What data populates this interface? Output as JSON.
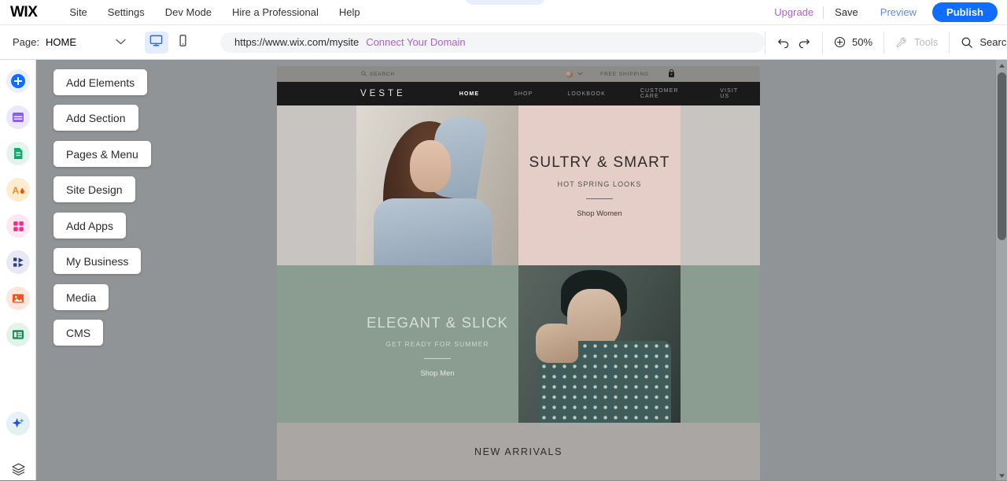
{
  "topbar": {
    "logo": "WIX",
    "menu": [
      {
        "label": "Site"
      },
      {
        "label": "Settings"
      },
      {
        "label": "Dev Mode"
      },
      {
        "label": "Hire a Professional"
      },
      {
        "label": "Help"
      }
    ],
    "upgrade_label": "Upgrade",
    "save_label": "Save",
    "preview_label": "Preview",
    "publish_label": "Publish",
    "publish_color": "#116dff",
    "upgrade_color": "#b65ad7",
    "preview_color": "#5b8bf6"
  },
  "toolbar": {
    "page_label": "Page:",
    "page_value": "HOME",
    "page_chevron": "chevron-down-icon",
    "desktop_icon": "desktop-view-icon",
    "mobile_icon": "mobile-view-icon",
    "active_device": "desktop",
    "url": "https://www.wix.com/mysite",
    "connect_domain_label": "Connect Your Domain",
    "connect_domain_color": "#b65ad7",
    "undo_icon": "undo-icon",
    "redo_icon": "redo-icon",
    "zoom_icon": "zoom-in-icon",
    "zoom_level": "50%",
    "tools_icon": "tools-icon",
    "tools_label": "Tools",
    "tools_disabled_color": "#bcbcbc",
    "search_icon": "search-icon",
    "search_label": "Search"
  },
  "rail": {
    "items": [
      {
        "name": "add-icon",
        "bg": "#e8f0fe",
        "fg": "#116dff"
      },
      {
        "name": "sections-icon",
        "bg": "#ede7fd",
        "fg": "#8b5cf6"
      },
      {
        "name": "pages-menu-icon",
        "bg": "#e2f5ec",
        "fg": "#16a86a"
      },
      {
        "name": "site-design-icon",
        "bg": "#fdeccd",
        "fg": "#f5851f"
      },
      {
        "name": "add-apps-icon",
        "bg": "#fde7f1",
        "fg": "#ec2c8f"
      },
      {
        "name": "my-business-icon",
        "bg": "#e7eaf4",
        "fg": "#2d3f8f"
      },
      {
        "name": "media-icon",
        "bg": "#fde6dc",
        "fg": "#f0531c"
      },
      {
        "name": "cms-icon",
        "bg": "#e2f3e9",
        "fg": "#0f8a52"
      }
    ],
    "bottom": [
      {
        "name": "ai-sparkle-icon"
      },
      {
        "name": "layers-icon"
      }
    ]
  },
  "panel": {
    "buttons": [
      {
        "label": "Add Elements"
      },
      {
        "label": "Add Section"
      },
      {
        "label": "Pages & Menu"
      },
      {
        "label": "Site Design"
      },
      {
        "label": "Add Apps"
      },
      {
        "label": "My Business"
      },
      {
        "label": "Media"
      },
      {
        "label": "CMS"
      }
    ]
  },
  "site": {
    "topstrip": {
      "search_icon": "search-icon",
      "search_label": "SEARCH",
      "region_icon": "region-flag-icon",
      "region_chevron": "chevron-down-icon",
      "shipping_label": "FREE SHIPPING",
      "bag_icon": "shopping-bag-icon"
    },
    "nav": {
      "brand": "VESTE",
      "links": [
        {
          "label": "HOME",
          "active": true
        },
        {
          "label": "SHOP",
          "active": false
        },
        {
          "label": "LOOKBOOK",
          "active": false
        },
        {
          "label": "CUSTOMER CARE",
          "active": false
        },
        {
          "label": "VISIT US",
          "active": false
        }
      ]
    },
    "hero_women": {
      "title": "SULTRY & SMART",
      "subtitle": "HOT SPRING LOOKS",
      "cta": "Shop Women",
      "bg_color": "#e5cdc8",
      "image_alt": "woman-in-denim-jacket-photo"
    },
    "hero_men": {
      "title": "ELEGANT & SLICK",
      "subtitle": "GET READY FOR SUMMER",
      "cta": "Shop Men",
      "bg_color": "#8b9d91",
      "image_alt": "man-in-patterned-shirt-photo"
    },
    "arrivals_title": "NEW ARRIVALS"
  },
  "scrollbar": {
    "up_icon": "scroll-up-arrow-icon",
    "down_icon": "scroll-down-arrow-icon",
    "thumb": "scrollbar-thumb"
  }
}
